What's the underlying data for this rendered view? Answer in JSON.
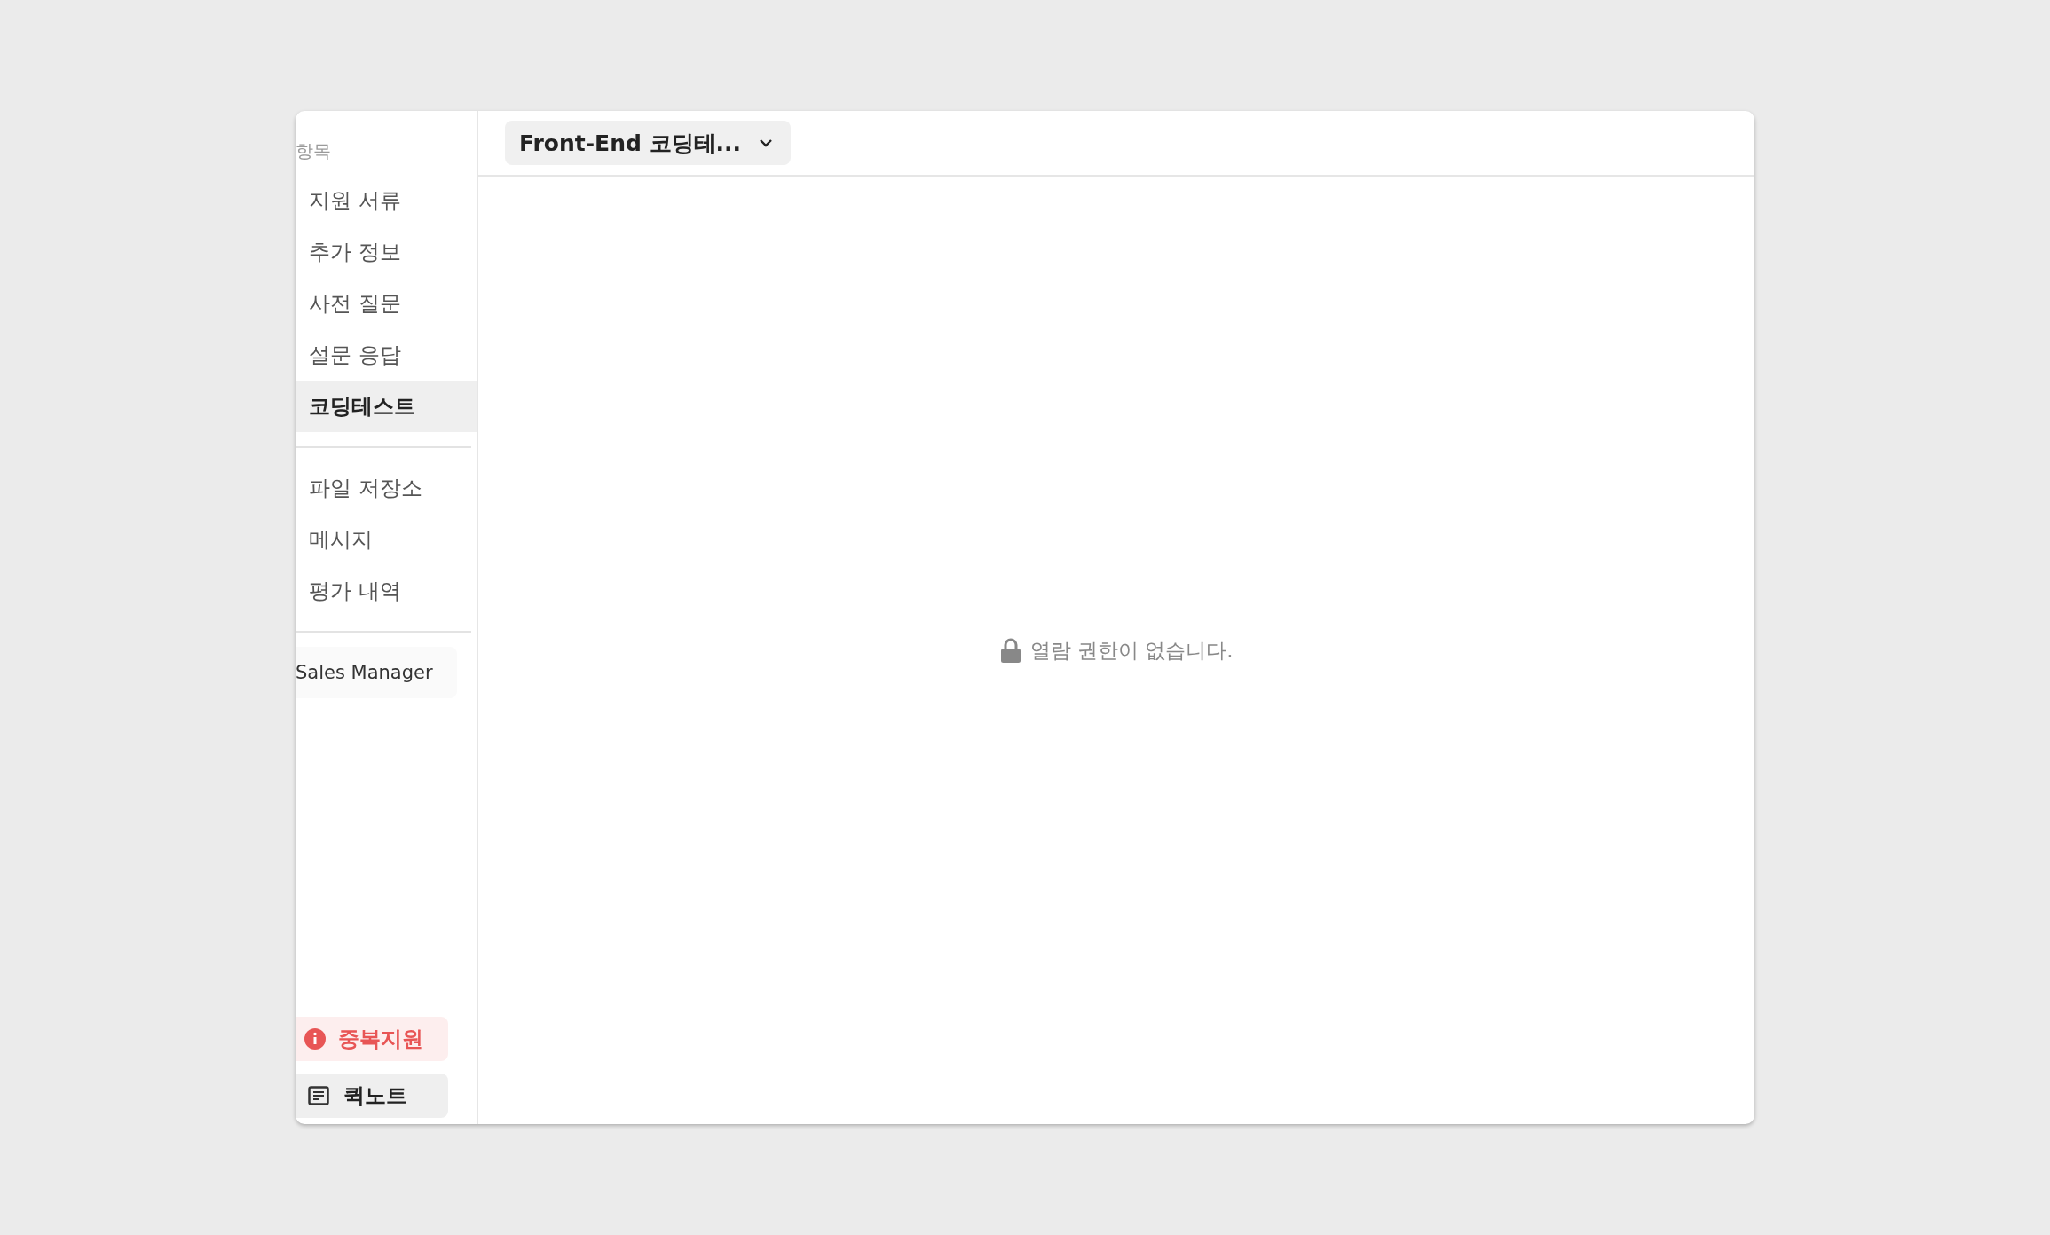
{
  "sidebar": {
    "section_label": "항목",
    "groups": [
      [
        {
          "label": "지원 서류",
          "selected": false
        },
        {
          "label": "추가 정보",
          "selected": false
        },
        {
          "label": "사전 질문",
          "selected": false
        },
        {
          "label": "설문 응답",
          "selected": false
        },
        {
          "label": "코딩테스트",
          "selected": true
        }
      ],
      [
        {
          "label": "파일 저장소",
          "selected": false
        },
        {
          "label": "메시지",
          "selected": false
        },
        {
          "label": "평가 내역",
          "selected": false
        }
      ]
    ],
    "tag": "Sales Manager",
    "bottom_buttons": [
      {
        "kind": "alert",
        "label": "중복지원"
      },
      {
        "kind": "note",
        "label": "퀵노트"
      }
    ]
  },
  "header": {
    "dropdown": {
      "label": "Front-End 코딩테..."
    }
  },
  "content": {
    "message": "열람 권한이 없습니다."
  }
}
